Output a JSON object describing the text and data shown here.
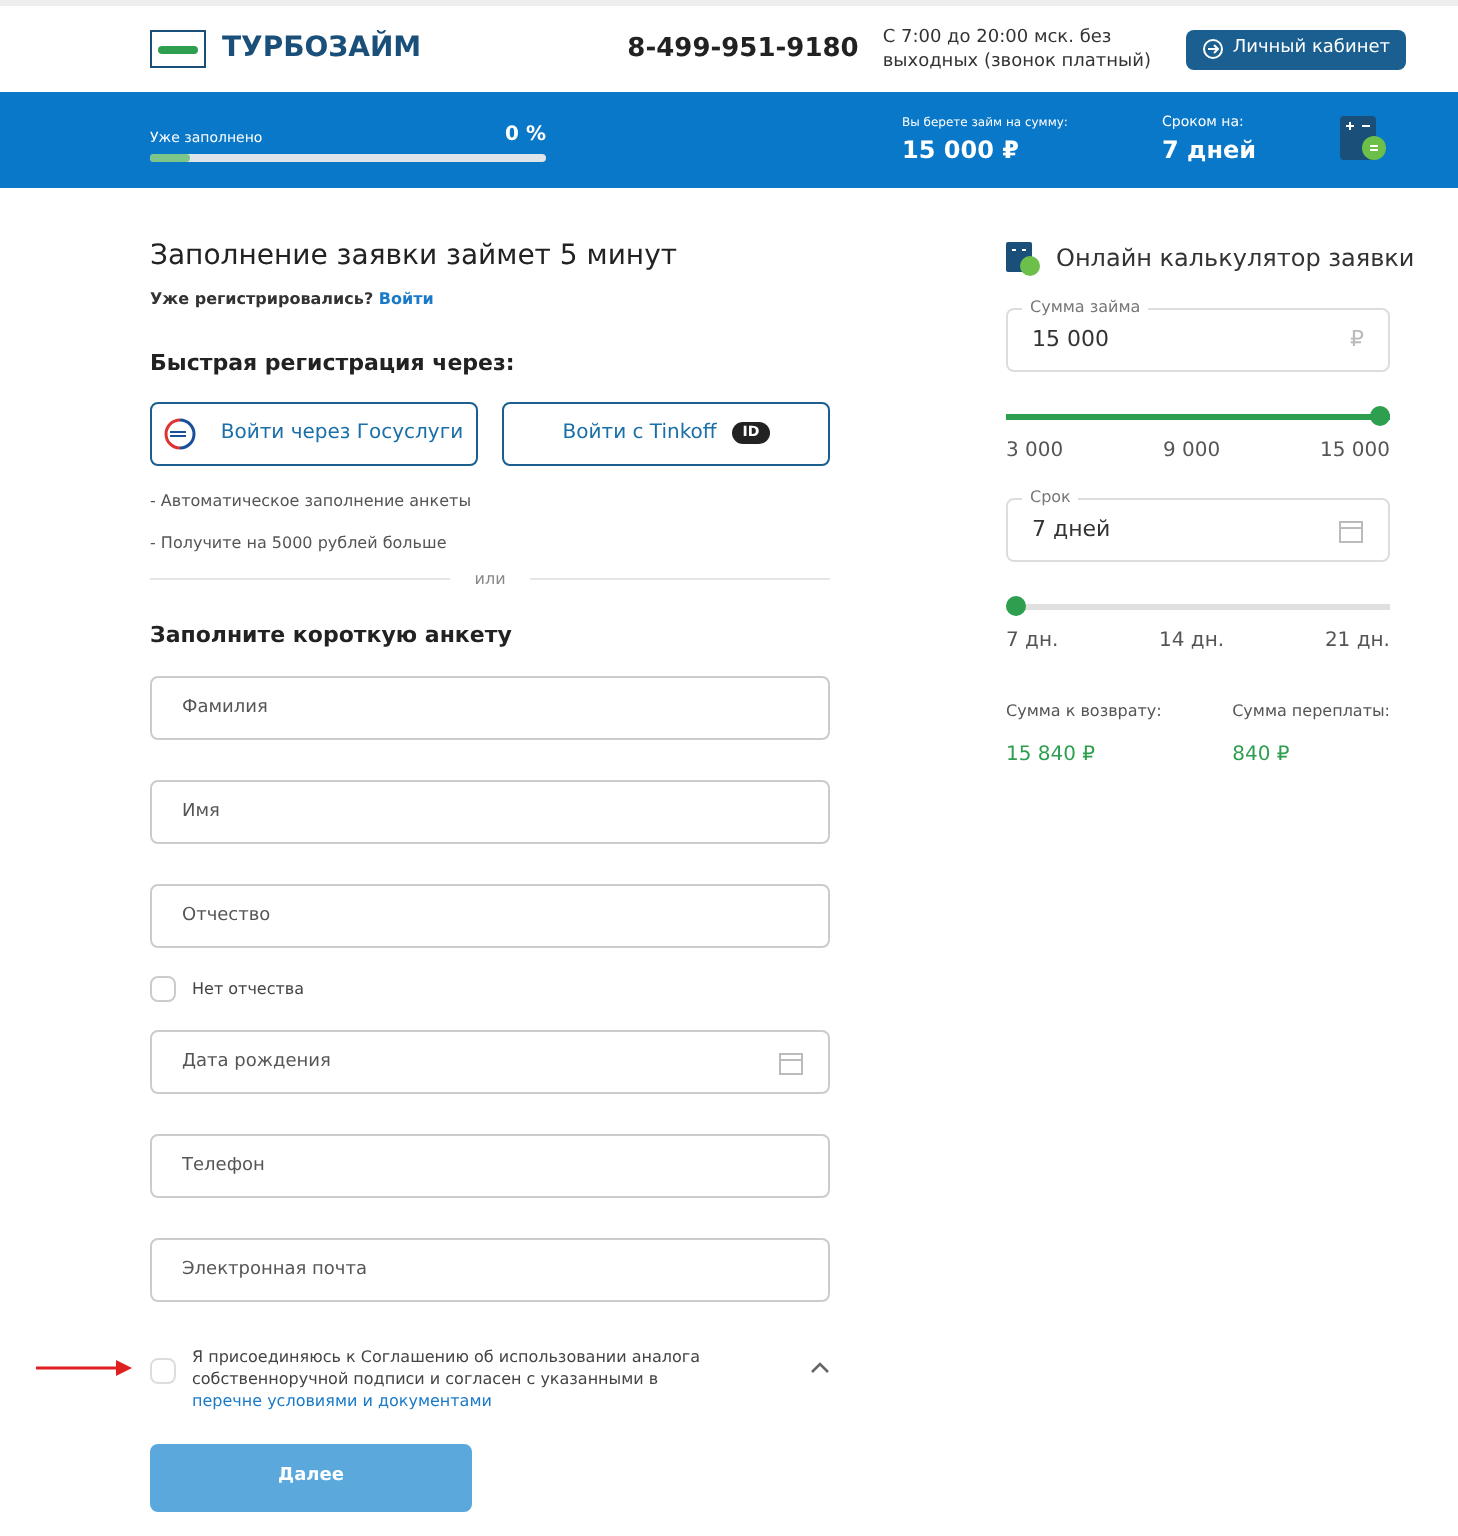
{
  "header": {
    "logo": "ТУРБОЗАЙМ",
    "phone": "8-499-951-9180",
    "hours": "С 7:00 до 20:00 мск. без выходных (звонок платный)",
    "cabinet_button": "Личный кабинет"
  },
  "progress_bar": {
    "label": "Уже заполнено",
    "percent": "0 %",
    "level": 0.1,
    "amount_label": "Вы берете займ на сумму:",
    "amount": "15 000 ₽",
    "term_label": "Сроком на:",
    "term": "7 дней"
  },
  "form": {
    "title": "Заполнение заявки займет 5 минут",
    "registered_prompt": "Уже регистрировались?",
    "login_link": "Войти",
    "quick_title": "Быстрая регистрация через:",
    "gosuslugi_button": "Войти через Госуслуги",
    "tinkoff_button": "Войти с Tinkoff",
    "tinkoff_badge": "ID",
    "benefits": [
      "- Автоматическое заполнение анкеты",
      "- Получите на 5000 рублей больше"
    ],
    "divider": "или",
    "short_form_title": "Заполните короткую анкету",
    "fields": [
      {
        "kind": "text",
        "placeholder": "Фамилия"
      },
      {
        "kind": "text",
        "placeholder": "Имя"
      },
      {
        "kind": "text",
        "placeholder": "Отчество"
      },
      {
        "kind": "checkbox",
        "label": "Нет отчества",
        "checked": false
      },
      {
        "kind": "date",
        "placeholder": "Дата рождения"
      },
      {
        "kind": "text",
        "placeholder": "Телефон"
      },
      {
        "kind": "text",
        "placeholder": "Электронная почта"
      }
    ],
    "consent": {
      "text": "Я присоединяюсь к Соглашению об использовании аналога собственноручной подписи и согласен с указанными в",
      "link": "перечне условиями и документами",
      "checked": false,
      "expanded": true
    },
    "next_button": "Далее"
  },
  "calculator": {
    "title": "Онлайн калькулятор заявки",
    "amount": {
      "label": "Сумма займа",
      "value": "15 000",
      "currency": "₽",
      "level": 1,
      "ticks": [
        "3 000",
        "9 000",
        "15 000"
      ]
    },
    "term": {
      "label": "Срок",
      "value": "7 дней",
      "level": 0,
      "ticks": [
        "7 дн.",
        "14 дн.",
        "21 дн."
      ]
    },
    "results": [
      {
        "label": "Сумма к возврату:",
        "value": "15 840 ₽"
      },
      {
        "label": "Сумма переплаты:",
        "value": "840 ₽"
      }
    ]
  }
}
